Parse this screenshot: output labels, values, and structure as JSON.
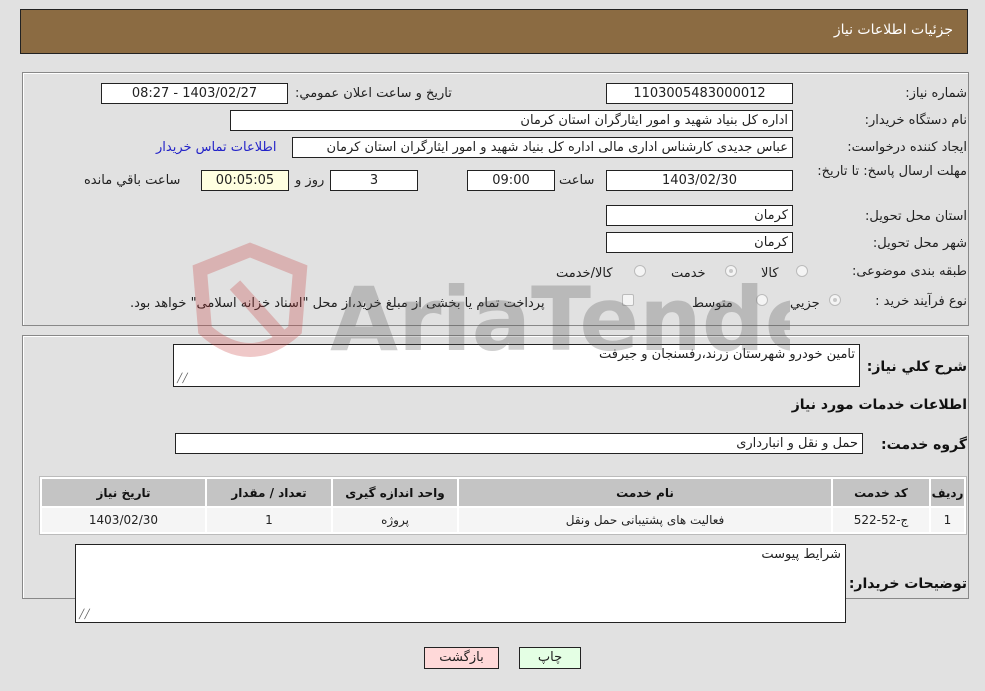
{
  "header": {
    "title": "جزئیات اطلاعات نیاز"
  },
  "form": {
    "need_number": {
      "label": "شماره نیاز:",
      "value": "1103005483000012"
    },
    "announce_datetime": {
      "label": "تاريخ و ساعت اعلان عمومي:",
      "value": "1403/02/27 - 08:27"
    },
    "buyer_org": {
      "label": "نام دستگاه خریدار:",
      "value": "اداره کل بنیاد شهید و امور ایثارگران استان کرمان"
    },
    "requester": {
      "label": "ایجاد کننده درخواست:",
      "value": "عباس جدیدی کارشناس اداری مالی اداره کل بنیاد شهید و امور ایثارگران استان کرمان",
      "contact_link": "اطلاعات تماس خریدار"
    },
    "deadline": {
      "label": "مهلت ارسال پاسخ: تا تاریخ:",
      "date": "1403/02/30",
      "time_label": "ساعت",
      "time": "09:00",
      "days": "3",
      "days_label": "روز و",
      "remaining": "00:05:05",
      "remaining_label": "ساعت باقي مانده"
    },
    "delivery_province": {
      "label": "استان محل تحویل:",
      "value": "کرمان"
    },
    "delivery_city": {
      "label": "شهر محل تحویل:",
      "value": "کرمان"
    },
    "category": {
      "label": "طبقه بندی موضوعی:",
      "options": [
        "کالا",
        "خدمت",
        "کالا/خدمت"
      ],
      "selected": "خدمت"
    },
    "purchase_type": {
      "label": "نوع فرآیند خرید :",
      "options": [
        "جزیي",
        "متوسط"
      ],
      "selected": "جزیي",
      "treasury_note": "پرداخت تمام یا بخشی از مبلغ خرید،از محل \"اسناد خزانه اسلامی\" خواهد بود."
    }
  },
  "details": {
    "summary_label": "شرح كلي نياز:",
    "summary_value": "تامین خودرو شهرستان زرند،رفسنجان و جیرفت",
    "services_title": "اطلاعات خدمات مورد نیاز",
    "service_group_label": "گروه خدمت:",
    "service_group_value": "حمل و نقل و انبارداری",
    "table": {
      "headers": [
        "ردیف",
        "کد خدمت",
        "نام خدمت",
        "واحد اندازه گیری",
        "تعداد / مقدار",
        "تاریخ نیاز"
      ],
      "rows": [
        [
          "1",
          "ج-52-522",
          "فعالیت های پشتیبانی حمل ونقل",
          "پروژه",
          "1",
          "1403/02/30"
        ]
      ]
    },
    "buyer_notes_label": "توضیحات خریدار:",
    "buyer_notes_value": "شرایط پیوست"
  },
  "buttons": {
    "print": "چاپ",
    "back": "بازگشت"
  },
  "watermark": {
    "text": "AriaTender.neT"
  }
}
